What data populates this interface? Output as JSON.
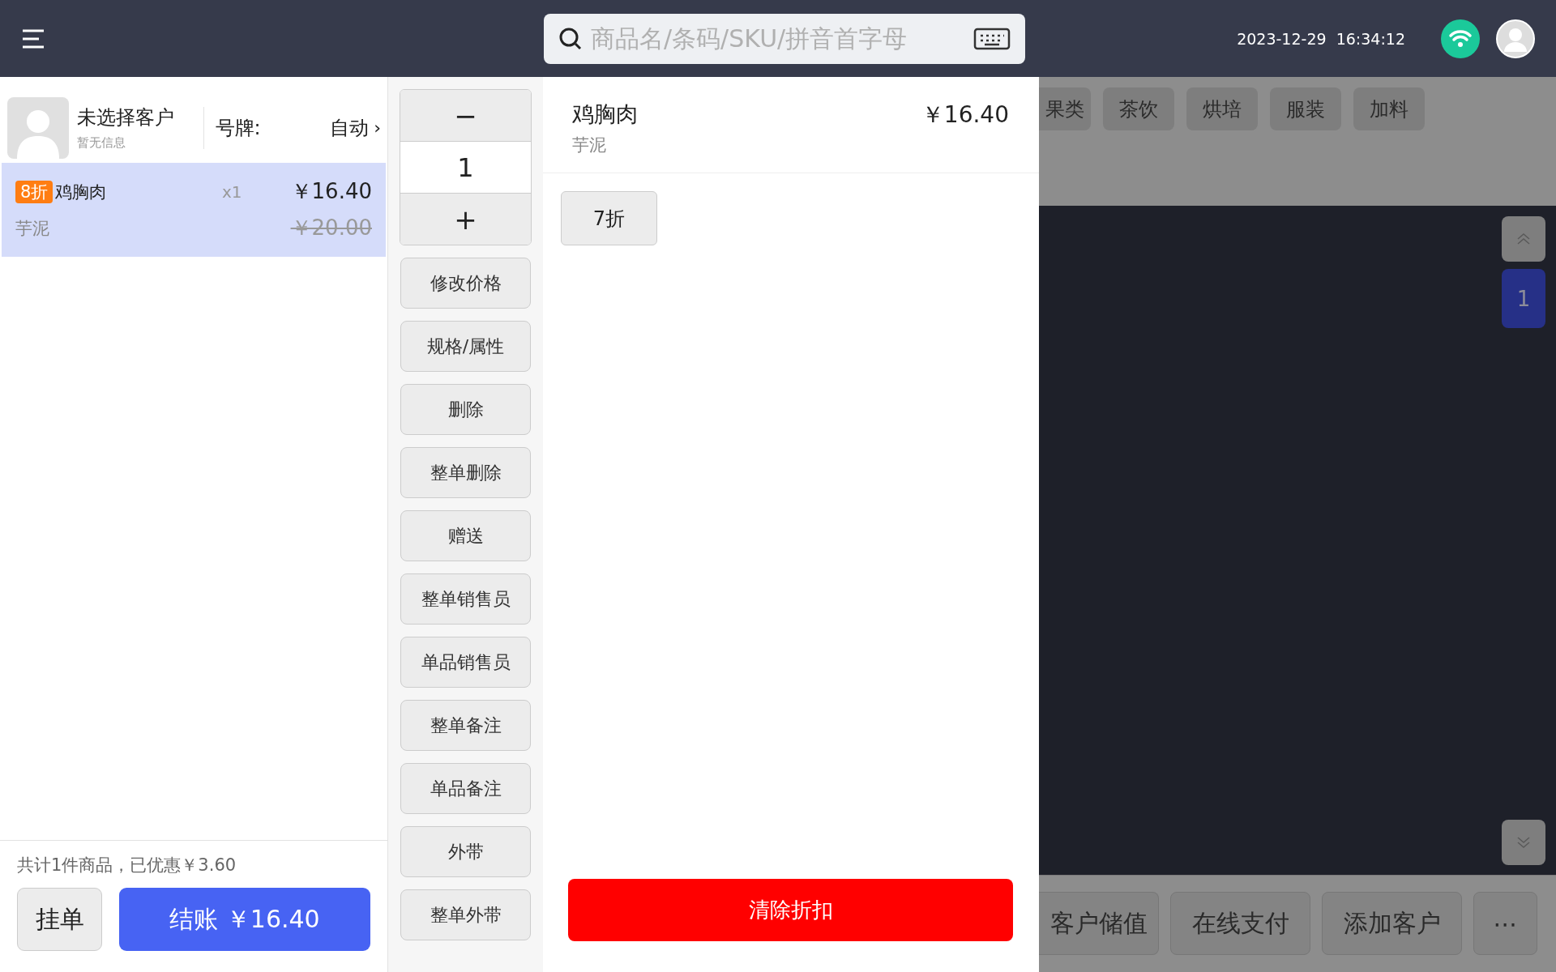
{
  "top_bar": {
    "search": {
      "placeholder": "商品名/条码/SKU/拼音首字母"
    },
    "datetime": "2023-12-29  16:34:12"
  },
  "customer": {
    "name": "未选择客户",
    "info": "暂无信息",
    "tag_label": "号牌:",
    "tag_value": "自动",
    "chevron": "›"
  },
  "cart_items": [
    {
      "badge": "8折",
      "name": "鸡胸肉",
      "quantity": "x1",
      "price": "￥16.40",
      "option": "芋泥",
      "original_price": "￥20.00",
      "selected": true
    }
  ],
  "summary": "共计1件商品，已优惠￥3.60",
  "actions": [
    {
      "label": "挂单",
      "kind": "secondary"
    },
    {
      "label": "结账 ￥16.40",
      "kind": "primary"
    }
  ],
  "stepper": {
    "minus": "−",
    "value": "1",
    "plus": "+"
  },
  "item_buttons": [
    "修改价格",
    "规格/属性",
    "删除",
    "整单删除",
    "赠送",
    "整单销售员",
    "单品销售员",
    "整单备注",
    "单品备注",
    "外带",
    "整单外带"
  ],
  "discount_panel": {
    "name": "鸡胸肉",
    "price": "￥16.40",
    "option": "芋泥",
    "discounts": [
      {
        "label": "7折",
        "selected": false
      }
    ],
    "clear_button": "清除折扣"
  },
  "categories": [
    {
      "label": "果类",
      "cut": true
    },
    {
      "label": "茶饮",
      "cut": false
    },
    {
      "label": "烘培",
      "cut": false
    },
    {
      "label": "服装",
      "cut": false
    },
    {
      "label": "加料",
      "cut": false
    }
  ],
  "pages": [
    {
      "label": "1",
      "selected": true
    }
  ],
  "bottom_buttons": [
    {
      "label": "客户储值",
      "cut": true
    },
    {
      "label": "在线支付",
      "cut": false
    },
    {
      "label": "添加客户",
      "cut": false
    },
    {
      "label": "⋯",
      "cut": false
    }
  ]
}
